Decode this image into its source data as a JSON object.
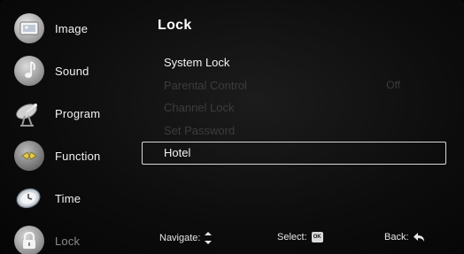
{
  "side_menu": {
    "items": [
      {
        "label": "Image",
        "icon": "image-icon"
      },
      {
        "label": "Sound",
        "icon": "music-note-icon"
      },
      {
        "label": "Program",
        "icon": "satellite-dish-icon"
      },
      {
        "label": "Function",
        "icon": "function-icon"
      },
      {
        "label": "Time",
        "icon": "clock-icon"
      },
      {
        "label": "Lock",
        "icon": "padlock-icon",
        "active": true
      }
    ]
  },
  "panel": {
    "title": "Lock",
    "options": [
      {
        "label": "System Lock",
        "state": "enabled"
      },
      {
        "label": "Parental Control",
        "value": "Off",
        "state": "disabled"
      },
      {
        "label": "Channel Lock",
        "state": "disabled"
      },
      {
        "label": "Set Password",
        "state": "disabled"
      },
      {
        "label": "Hotel",
        "state": "selected"
      }
    ]
  },
  "hints": {
    "navigate": "Navigate:",
    "select": "Select:",
    "select_key": "OK",
    "back": "Back:"
  },
  "colors": {
    "background": "#0d0d0d",
    "text": "#f3f3f3",
    "disabled_text": "#3c3c3c",
    "selection_border": "#d8d8d8"
  }
}
